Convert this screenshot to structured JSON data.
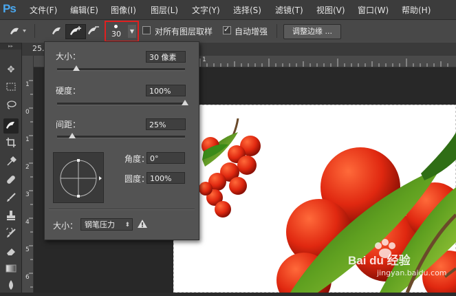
{
  "app": {
    "logo": "Ps"
  },
  "menu": [
    "文件(F)",
    "编辑(E)",
    "图像(I)",
    "图层(L)",
    "文字(Y)",
    "选择(S)",
    "滤镜(T)",
    "视图(V)",
    "窗口(W)",
    "帮助(H)"
  ],
  "options": {
    "brush_size_value": "30",
    "sample_all_layers_label": "对所有图层取样",
    "sample_all_layers_checked": false,
    "auto_enhance_label": "自动增强",
    "auto_enhance_checked": true,
    "refine_edge_label": "调整边缘 ..."
  },
  "document_tab": {
    "label": "25."
  },
  "ruler": {
    "vertical_ticks": [
      "1",
      "0",
      "1",
      "2",
      "3",
      "4",
      "5",
      "6"
    ],
    "horizontal_ticks": [
      "1"
    ]
  },
  "brush_popup": {
    "size_label": "大小：",
    "size_value": "30 像素",
    "size_fraction": 0.15,
    "hardness_label": "硬度：",
    "hardness_value": "100%",
    "hardness_fraction": 1.0,
    "spacing_label": "间距：",
    "spacing_value": "25%",
    "spacing_fraction": 0.12,
    "angle_label": "角度：",
    "angle_value": "0°",
    "roundness_label": "圆度：",
    "roundness_value": "100%",
    "pen_size_label": "大小：",
    "pen_size_option": "钢笔压力"
  },
  "watermark": {
    "brand": "Bai du 经验",
    "url": "jingyan.baidu.com"
  },
  "colors": {
    "logo_blue": "#4aa8f0",
    "highlight_red": "#e02020",
    "panel_gray": "#535353"
  }
}
